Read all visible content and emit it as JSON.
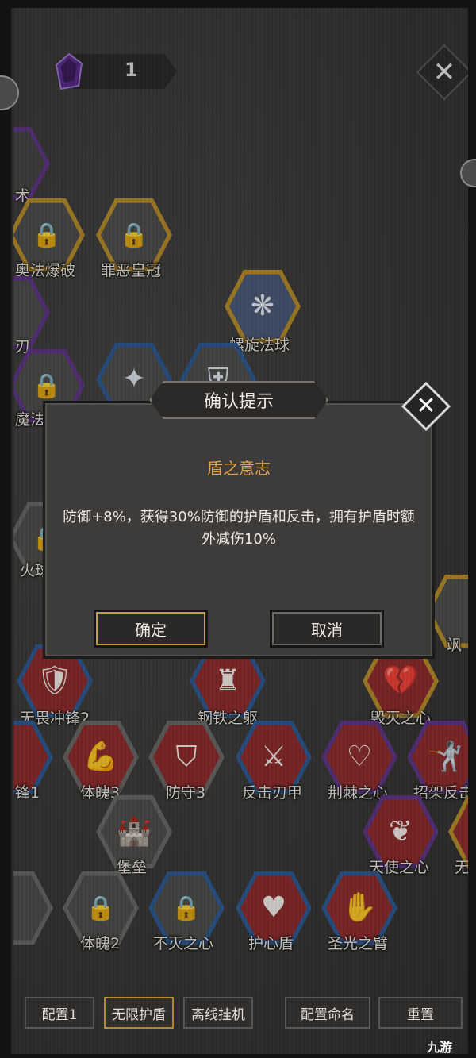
{
  "top_bar": {
    "currency_value": "1"
  },
  "nodes": [
    {
      "label": "术"
    },
    {
      "label": "奥法爆破"
    },
    {
      "label": "罪恶皇冠"
    },
    {
      "label": "螺旋法球"
    },
    {
      "label": "刃"
    },
    {
      "label": "魔法"
    },
    {
      "label": "火球"
    },
    {
      "label": "飒"
    },
    {
      "label": "无畏冲锋2"
    },
    {
      "label": "钢铁之躯"
    },
    {
      "label": "毁灭之心"
    },
    {
      "label": "锋1"
    },
    {
      "label": "体魄3"
    },
    {
      "label": "防守3"
    },
    {
      "label": "反击刃甲"
    },
    {
      "label": "荆棘之心"
    },
    {
      "label": "招架反击"
    },
    {
      "label": "堡垒"
    },
    {
      "label": "天使之心"
    },
    {
      "label": "无"
    },
    {
      "label": "体魄2"
    },
    {
      "label": "不灭之心"
    },
    {
      "label": "护心盾"
    },
    {
      "label": "圣光之臂"
    }
  ],
  "dialog": {
    "title": "确认提示",
    "skill_name": "盾之意志",
    "description": "防御+8%，获得30%防御的护盾和反击，拥有护盾时额外减伤10%",
    "confirm_label": "确定",
    "cancel_label": "取消",
    "close_symbol": "✕"
  },
  "bottom_bar": {
    "config1": "配置1",
    "unlimited_shield": "无限护盾",
    "offline_idle": "离线挂机",
    "config_rename": "配置命名",
    "reset": "重置"
  },
  "watermark": "九游",
  "colors": {
    "accent_gold": "#c79c3e",
    "skill_name": "#e0a24a",
    "node_red": "#8e2b2b"
  }
}
